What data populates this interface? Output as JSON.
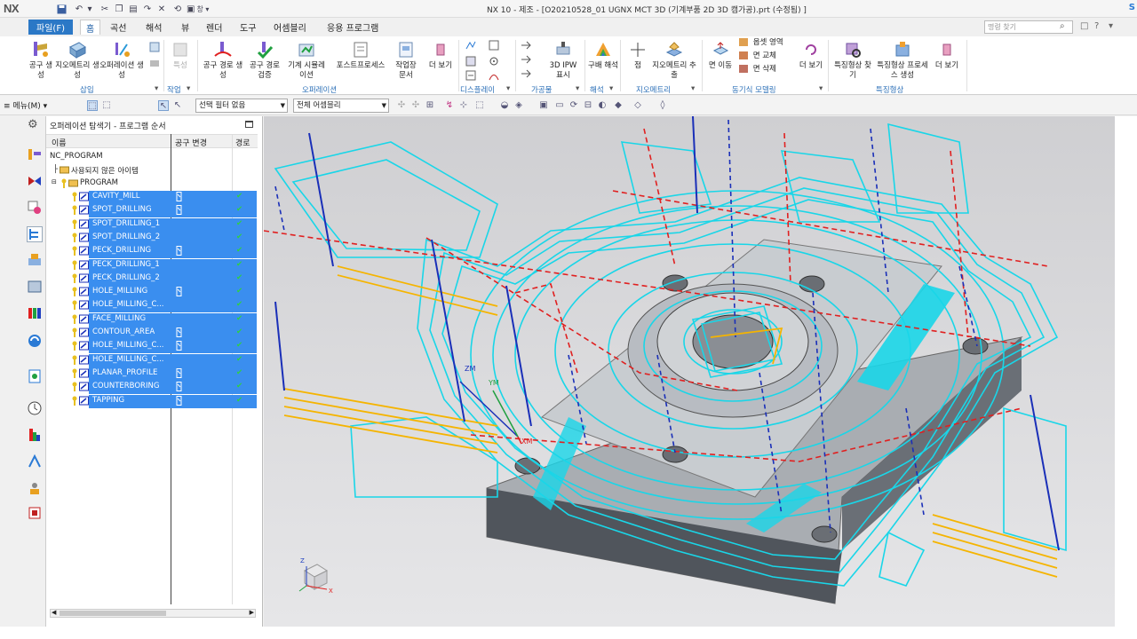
{
  "app": {
    "logo": "NX",
    "title": "NX 10 - 제조 - [O20210528_01 UGNX MCT 3D (기계부품 2D 3D 캠가공).prt (수정됨) ]",
    "corner_logo": "S",
    "quick_access_window": "창 ▾"
  },
  "tabs": {
    "file": "파일(F)",
    "items": [
      "홈",
      "곡선",
      "해석",
      "뷰",
      "렌더",
      "도구",
      "어셈블리",
      "응용 프로그램"
    ],
    "active": "홈"
  },
  "command_search": {
    "placeholder": "명령 찾기"
  },
  "ribbon": {
    "groups": [
      {
        "label": "삽입",
        "buttons": [
          "공구 생성",
          "지오메트리 생성",
          "오퍼레이션 생성"
        ]
      },
      {
        "label": "작업",
        "buttons": [
          "특성"
        ]
      },
      {
        "label": "오퍼레이션",
        "buttons": [
          "공구 경로 생성",
          "공구 경로 검증",
          "기계 시뮬레이션",
          "포스트프로세스",
          "작업장 문서",
          "더 보기"
        ]
      },
      {
        "label": "디스플레이",
        "buttons": []
      },
      {
        "label": "가공물",
        "buttons": [
          "3D IPW 표시"
        ]
      },
      {
        "label": "해석",
        "buttons": [
          "구배 해석"
        ]
      },
      {
        "label": "지오메트리",
        "buttons": [
          "점",
          "지오메트리 추출"
        ]
      },
      {
        "label": "동기식 모델링",
        "buttons": [
          "면 이동",
          "옵셋 영역",
          "면 교체",
          "면 삭제",
          "더 보기"
        ]
      },
      {
        "label": "특징형상",
        "buttons": [
          "특징형상 찾기",
          "특징형상 프로세스 생성",
          "더 보기"
        ]
      }
    ]
  },
  "selection_toolbar": {
    "menu": "메뉴(M) ▾",
    "filter": "선택 필터 없음",
    "scope": "전체 어셈블리"
  },
  "navigator": {
    "title": "오퍼레이션 탐색기 - 프로그램 순서",
    "columns": [
      "이름",
      "공구 변경",
      "경로"
    ],
    "root": "NC_PROGRAM",
    "unused": "사용되지 않은 아이템",
    "program": "PROGRAM",
    "operations": [
      {
        "name": "CAVITY_MILL",
        "tool_change": true
      },
      {
        "name": "SPOT_DRILLING",
        "tool_change": true
      },
      {
        "name": "SPOT_DRILLING_1",
        "tool_change": false
      },
      {
        "name": "SPOT_DRILLING_2",
        "tool_change": false
      },
      {
        "name": "PECK_DRILLING",
        "tool_change": true
      },
      {
        "name": "PECK_DRILLING_1",
        "tool_change": false
      },
      {
        "name": "PECK_DRILLING_2",
        "tool_change": false
      },
      {
        "name": "HOLE_MILLING",
        "tool_change": true
      },
      {
        "name": "HOLE_MILLING_C...",
        "tool_change": false
      },
      {
        "name": "FACE_MILLING",
        "tool_change": false
      },
      {
        "name": "CONTOUR_AREA",
        "tool_change": true
      },
      {
        "name": "HOLE_MILLING_C...",
        "tool_change": true
      },
      {
        "name": "HOLE_MILLING_C...",
        "tool_change": false
      },
      {
        "name": "PLANAR_PROFILE",
        "tool_change": true
      },
      {
        "name": "COUNTERBORING",
        "tool_change": true
      },
      {
        "name": "TAPPING",
        "tool_change": true
      }
    ]
  },
  "viewport": {
    "axes": {
      "zm": "ZM",
      "ym": "YM",
      "xm": "XM",
      "triad_z": "Z",
      "triad_x": "X"
    }
  },
  "colors": {
    "accent": "#2b78c6",
    "selection": "#3a8eef",
    "toolpath_cyan": "#19d6e8",
    "rapid_red": "#e02020",
    "plunge_blue": "#1a2fb8",
    "engage_orange": "#f5b400"
  }
}
